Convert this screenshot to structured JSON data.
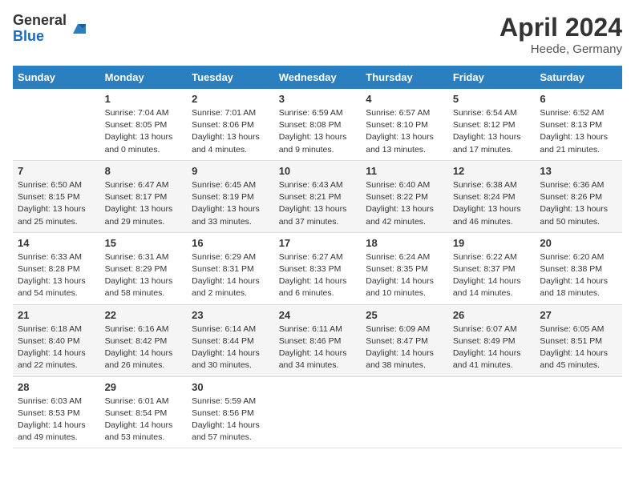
{
  "header": {
    "logo_general": "General",
    "logo_blue": "Blue",
    "title": "April 2024",
    "location": "Heede, Germany"
  },
  "weekdays": [
    "Sunday",
    "Monday",
    "Tuesday",
    "Wednesday",
    "Thursday",
    "Friday",
    "Saturday"
  ],
  "weeks": [
    [
      {
        "day": "",
        "info": []
      },
      {
        "day": "1",
        "info": [
          "Sunrise: 7:04 AM",
          "Sunset: 8:05 PM",
          "Daylight: 13 hours",
          "and 0 minutes."
        ]
      },
      {
        "day": "2",
        "info": [
          "Sunrise: 7:01 AM",
          "Sunset: 8:06 PM",
          "Daylight: 13 hours",
          "and 4 minutes."
        ]
      },
      {
        "day": "3",
        "info": [
          "Sunrise: 6:59 AM",
          "Sunset: 8:08 PM",
          "Daylight: 13 hours",
          "and 9 minutes."
        ]
      },
      {
        "day": "4",
        "info": [
          "Sunrise: 6:57 AM",
          "Sunset: 8:10 PM",
          "Daylight: 13 hours",
          "and 13 minutes."
        ]
      },
      {
        "day": "5",
        "info": [
          "Sunrise: 6:54 AM",
          "Sunset: 8:12 PM",
          "Daylight: 13 hours",
          "and 17 minutes."
        ]
      },
      {
        "day": "6",
        "info": [
          "Sunrise: 6:52 AM",
          "Sunset: 8:13 PM",
          "Daylight: 13 hours",
          "and 21 minutes."
        ]
      }
    ],
    [
      {
        "day": "7",
        "info": [
          "Sunrise: 6:50 AM",
          "Sunset: 8:15 PM",
          "Daylight: 13 hours",
          "and 25 minutes."
        ]
      },
      {
        "day": "8",
        "info": [
          "Sunrise: 6:47 AM",
          "Sunset: 8:17 PM",
          "Daylight: 13 hours",
          "and 29 minutes."
        ]
      },
      {
        "day": "9",
        "info": [
          "Sunrise: 6:45 AM",
          "Sunset: 8:19 PM",
          "Daylight: 13 hours",
          "and 33 minutes."
        ]
      },
      {
        "day": "10",
        "info": [
          "Sunrise: 6:43 AM",
          "Sunset: 8:21 PM",
          "Daylight: 13 hours",
          "and 37 minutes."
        ]
      },
      {
        "day": "11",
        "info": [
          "Sunrise: 6:40 AM",
          "Sunset: 8:22 PM",
          "Daylight: 13 hours",
          "and 42 minutes."
        ]
      },
      {
        "day": "12",
        "info": [
          "Sunrise: 6:38 AM",
          "Sunset: 8:24 PM",
          "Daylight: 13 hours",
          "and 46 minutes."
        ]
      },
      {
        "day": "13",
        "info": [
          "Sunrise: 6:36 AM",
          "Sunset: 8:26 PM",
          "Daylight: 13 hours",
          "and 50 minutes."
        ]
      }
    ],
    [
      {
        "day": "14",
        "info": [
          "Sunrise: 6:33 AM",
          "Sunset: 8:28 PM",
          "Daylight: 13 hours",
          "and 54 minutes."
        ]
      },
      {
        "day": "15",
        "info": [
          "Sunrise: 6:31 AM",
          "Sunset: 8:29 PM",
          "Daylight: 13 hours",
          "and 58 minutes."
        ]
      },
      {
        "day": "16",
        "info": [
          "Sunrise: 6:29 AM",
          "Sunset: 8:31 PM",
          "Daylight: 14 hours",
          "and 2 minutes."
        ]
      },
      {
        "day": "17",
        "info": [
          "Sunrise: 6:27 AM",
          "Sunset: 8:33 PM",
          "Daylight: 14 hours",
          "and 6 minutes."
        ]
      },
      {
        "day": "18",
        "info": [
          "Sunrise: 6:24 AM",
          "Sunset: 8:35 PM",
          "Daylight: 14 hours",
          "and 10 minutes."
        ]
      },
      {
        "day": "19",
        "info": [
          "Sunrise: 6:22 AM",
          "Sunset: 8:37 PM",
          "Daylight: 14 hours",
          "and 14 minutes."
        ]
      },
      {
        "day": "20",
        "info": [
          "Sunrise: 6:20 AM",
          "Sunset: 8:38 PM",
          "Daylight: 14 hours",
          "and 18 minutes."
        ]
      }
    ],
    [
      {
        "day": "21",
        "info": [
          "Sunrise: 6:18 AM",
          "Sunset: 8:40 PM",
          "Daylight: 14 hours",
          "and 22 minutes."
        ]
      },
      {
        "day": "22",
        "info": [
          "Sunrise: 6:16 AM",
          "Sunset: 8:42 PM",
          "Daylight: 14 hours",
          "and 26 minutes."
        ]
      },
      {
        "day": "23",
        "info": [
          "Sunrise: 6:14 AM",
          "Sunset: 8:44 PM",
          "Daylight: 14 hours",
          "and 30 minutes."
        ]
      },
      {
        "day": "24",
        "info": [
          "Sunrise: 6:11 AM",
          "Sunset: 8:46 PM",
          "Daylight: 14 hours",
          "and 34 minutes."
        ]
      },
      {
        "day": "25",
        "info": [
          "Sunrise: 6:09 AM",
          "Sunset: 8:47 PM",
          "Daylight: 14 hours",
          "and 38 minutes."
        ]
      },
      {
        "day": "26",
        "info": [
          "Sunrise: 6:07 AM",
          "Sunset: 8:49 PM",
          "Daylight: 14 hours",
          "and 41 minutes."
        ]
      },
      {
        "day": "27",
        "info": [
          "Sunrise: 6:05 AM",
          "Sunset: 8:51 PM",
          "Daylight: 14 hours",
          "and 45 minutes."
        ]
      }
    ],
    [
      {
        "day": "28",
        "info": [
          "Sunrise: 6:03 AM",
          "Sunset: 8:53 PM",
          "Daylight: 14 hours",
          "and 49 minutes."
        ]
      },
      {
        "day": "29",
        "info": [
          "Sunrise: 6:01 AM",
          "Sunset: 8:54 PM",
          "Daylight: 14 hours",
          "and 53 minutes."
        ]
      },
      {
        "day": "30",
        "info": [
          "Sunrise: 5:59 AM",
          "Sunset: 8:56 PM",
          "Daylight: 14 hours",
          "and 57 minutes."
        ]
      },
      {
        "day": "",
        "info": []
      },
      {
        "day": "",
        "info": []
      },
      {
        "day": "",
        "info": []
      },
      {
        "day": "",
        "info": []
      }
    ]
  ]
}
